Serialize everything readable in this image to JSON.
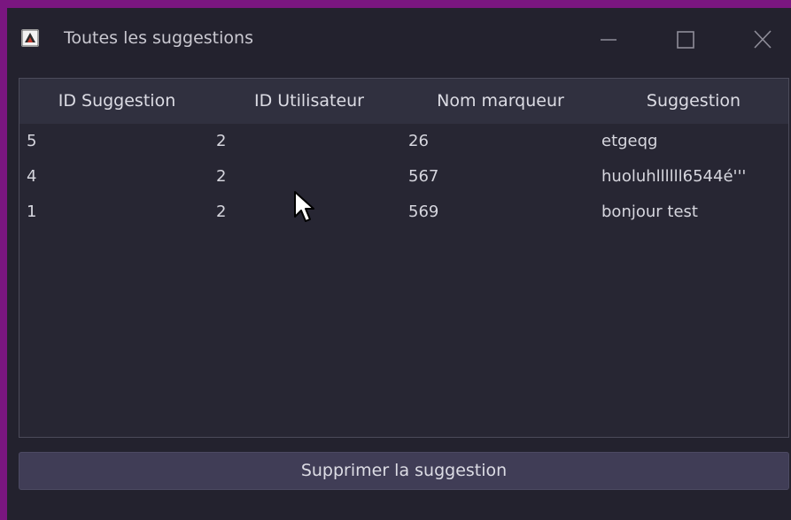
{
  "window": {
    "title": "Toutes les suggestions",
    "icon": "app-icon",
    "controls": [
      "minimize-icon",
      "maximize-icon",
      "close-icon"
    ]
  },
  "table": {
    "columns": [
      "ID Suggestion",
      "ID Utilisateur",
      "Nom marqueur",
      "Suggestion"
    ],
    "rows": [
      [
        "5",
        "2",
        "26",
        "etgeqg"
      ],
      [
        "4",
        "2",
        "567",
        "huoluhllllll6544é'''"
      ],
      [
        "1",
        "2",
        "569",
        "bonjour test"
      ]
    ]
  },
  "actions": {
    "delete_label": "Supprimer la suggestion"
  },
  "colors": {
    "desktop": "#7a1680",
    "window_bg": "#23222e",
    "header_bg": "#30303f",
    "button_bg": "#403d56",
    "text": "#dcdce4"
  }
}
